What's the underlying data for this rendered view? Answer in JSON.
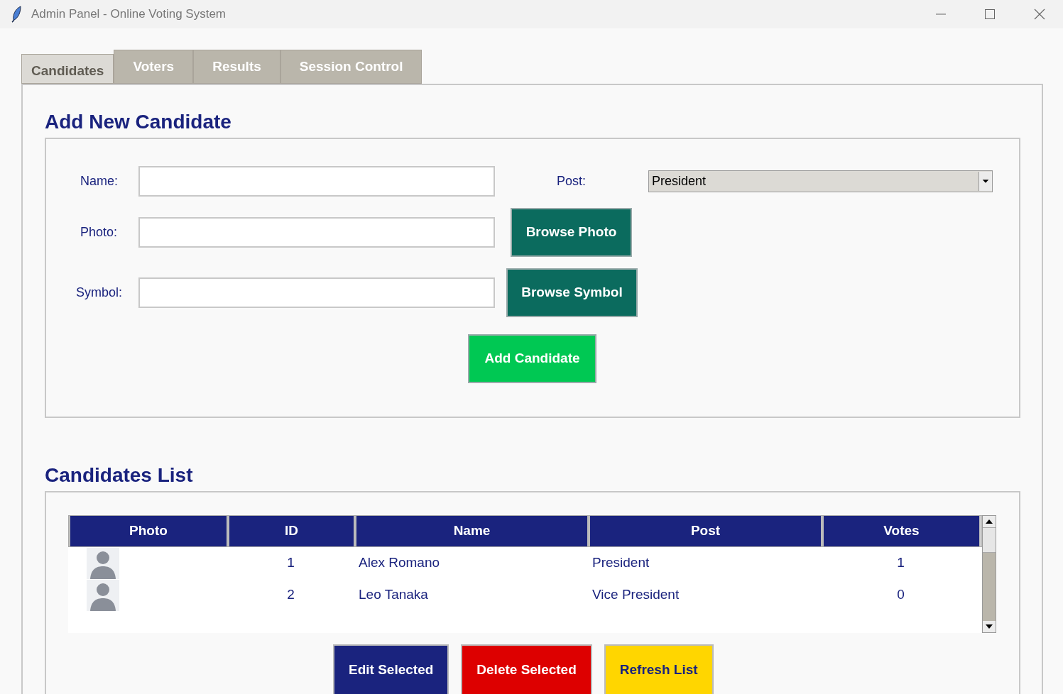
{
  "window": {
    "title": "Admin Panel - Online Voting System"
  },
  "tabs": [
    {
      "label": "Candidates",
      "selected": true
    },
    {
      "label": "Voters",
      "selected": false
    },
    {
      "label": "Results",
      "selected": false
    },
    {
      "label": "Session Control",
      "selected": false
    }
  ],
  "add_section": {
    "title": "Add New Candidate",
    "name_label": "Name:",
    "post_label": "Post:",
    "post_value": "President",
    "photo_label": "Photo:",
    "photo_button": "Browse Photo",
    "symbol_label": "Symbol:",
    "symbol_button": "Browse Symbol",
    "add_button": "Add Candidate"
  },
  "list_section": {
    "title": "Candidates List",
    "columns": [
      "Photo",
      "ID",
      "Name",
      "Post",
      "Votes"
    ],
    "rows": [
      {
        "id": "1",
        "name": "Alex Romano",
        "post": "President",
        "votes": "1"
      },
      {
        "id": "2",
        "name": "Leo Tanaka",
        "post": "Vice President",
        "votes": "0"
      }
    ],
    "buttons": [
      {
        "label": "Edit Selected",
        "kind": "edit"
      },
      {
        "label": "Delete Selected",
        "kind": "delete"
      },
      {
        "label": "Refresh List",
        "kind": "refresh"
      }
    ]
  }
}
